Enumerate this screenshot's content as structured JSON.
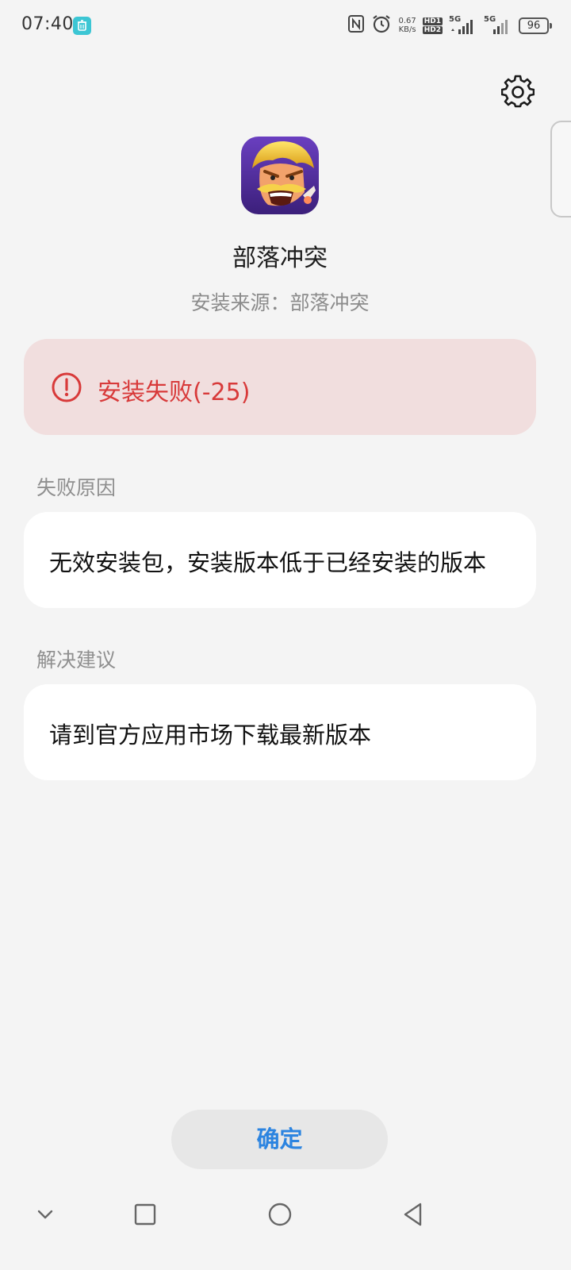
{
  "status_bar": {
    "time": "07:40",
    "net_speed_value": "0.67",
    "net_speed_unit": "KB/s",
    "hd1": "HD1",
    "hd2": "HD2",
    "signal1_label": "5G",
    "signal2_label": "5G",
    "battery": "96"
  },
  "app": {
    "name": "部落冲突",
    "install_source": "安装来源：部落冲突"
  },
  "error": {
    "message": "安装失败(-25)",
    "color": "#d83a3a"
  },
  "failure_reason": {
    "label": "失败原因",
    "text": "无效安装包，安装版本低于已经安装的版本"
  },
  "suggestion": {
    "label": "解决建议",
    "text": "请到官方应用市场下载最新版本"
  },
  "confirm_label": "确定",
  "accent_color": "#2c84e0",
  "icons": {
    "settings": "gear-icon",
    "error": "exclamation-circle-icon",
    "nav": [
      "chevron-down-icon",
      "square-icon",
      "circle-icon",
      "triangle-back-icon"
    ]
  }
}
